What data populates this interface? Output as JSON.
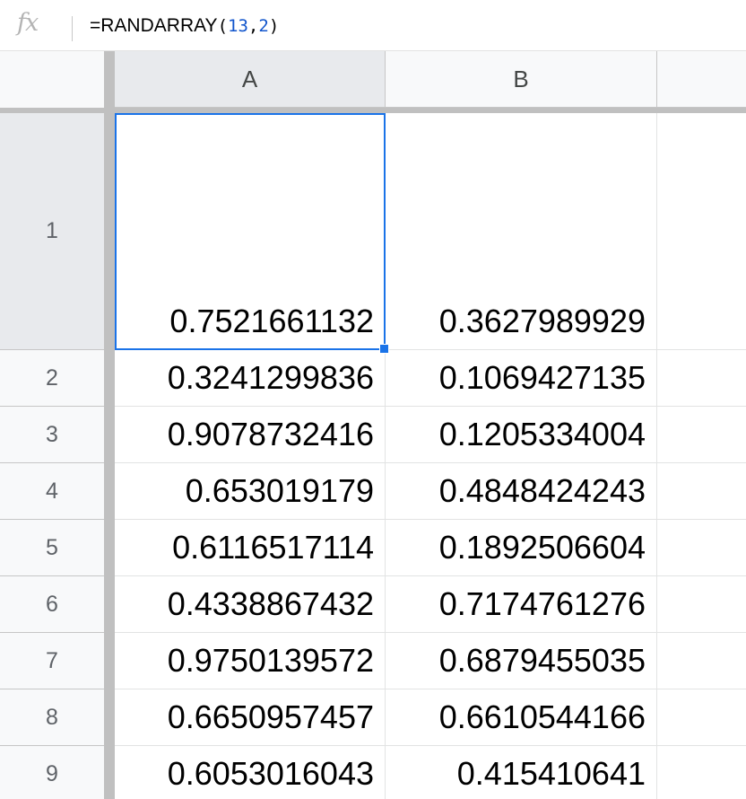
{
  "formula_bar": {
    "fx_label": "fx",
    "formula": {
      "prefix": "=RANDARRAY",
      "open": "(",
      "arg1": "13",
      "comma": ",",
      "arg2": "2",
      "close": ")"
    }
  },
  "columns": [
    "A",
    "B"
  ],
  "rows": [
    {
      "label": "1",
      "a": "0.7521661132",
      "b": "0.3627989929"
    },
    {
      "label": "2",
      "a": "0.3241299836",
      "b": "0.1069427135"
    },
    {
      "label": "3",
      "a": "0.9078732416",
      "b": "0.1205334004"
    },
    {
      "label": "4",
      "a": "0.653019179",
      "b": "0.4848424243"
    },
    {
      "label": "5",
      "a": "0.6116517114",
      "b": "0.1892506604"
    },
    {
      "label": "6",
      "a": "0.4338867432",
      "b": "0.7174761276"
    },
    {
      "label": "7",
      "a": "0.9750139572",
      "b": "0.6879455035"
    },
    {
      "label": "8",
      "a": "0.6650957457",
      "b": "0.6610544166"
    },
    {
      "label": "9",
      "a": "0.6053016043",
      "b": "0.415410641"
    }
  ],
  "colors": {
    "selection": "#1a73e8",
    "formula_argument": "#1155cc",
    "header_bg": "#f8f9fa",
    "header_active_bg": "#e8eaed",
    "freeze_bar": "#c0c0c0"
  }
}
